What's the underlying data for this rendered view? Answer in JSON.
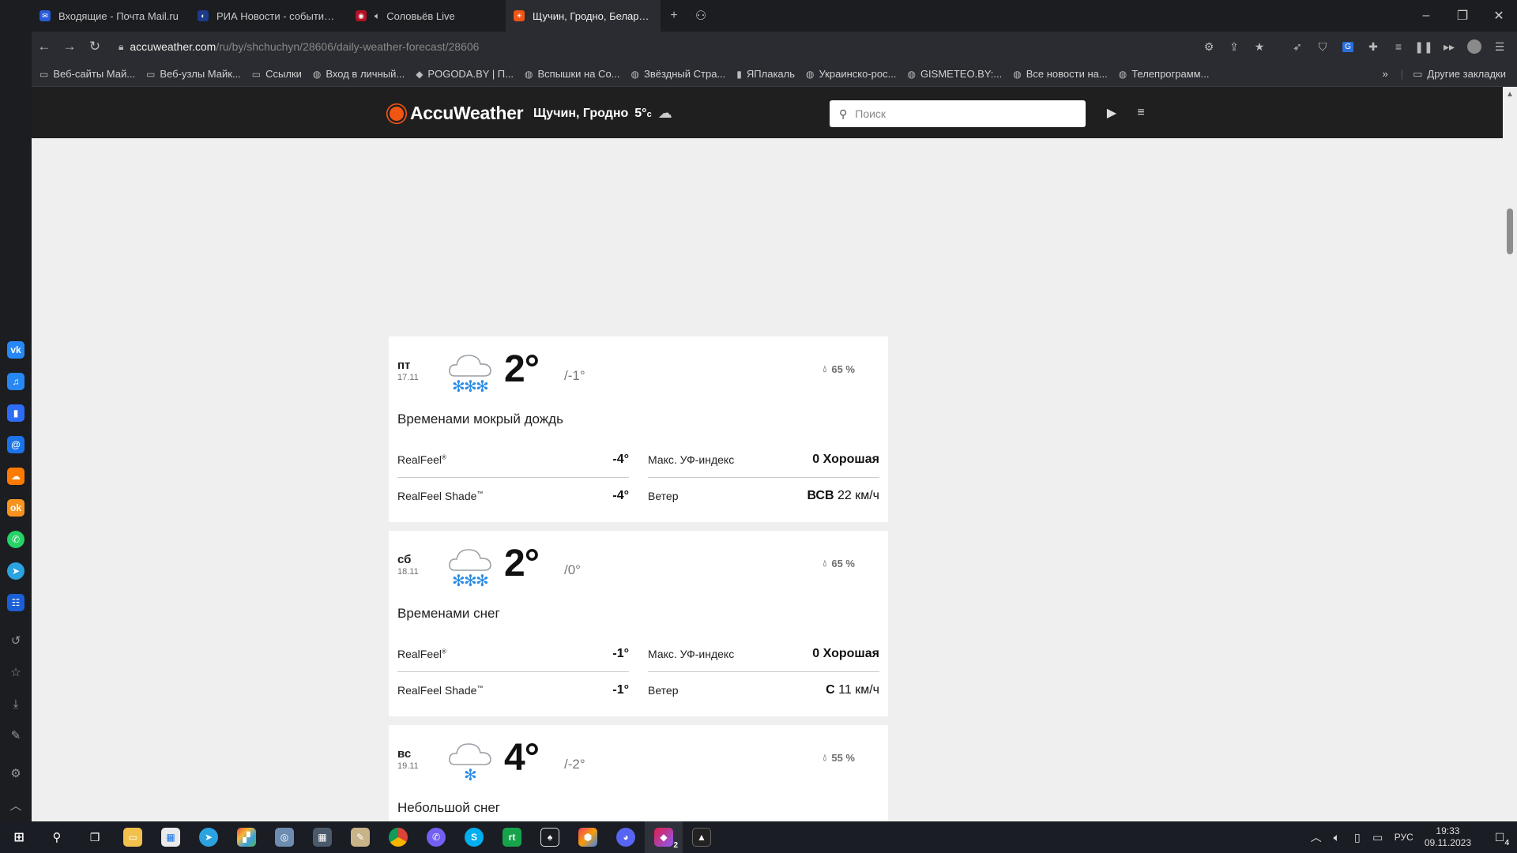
{
  "browser": {
    "tabs": [
      {
        "title": "Входящие - Почта Mail.ru",
        "color": "#2a5bd7",
        "glyph": "✉",
        "audio": false,
        "active": false
      },
      {
        "title": "РИА Новости - события в М",
        "color": "#1e3a8a",
        "glyph": "◐",
        "audio": false,
        "active": false
      },
      {
        "title": "Соловьёв Live",
        "color": "#b11226",
        "glyph": "◉",
        "audio": true,
        "active": false
      },
      {
        "title": "Щучин, Гродно, Беларусь Е",
        "color": "#f05514",
        "glyph": "☀",
        "audio": false,
        "active": true
      }
    ],
    "new_tab": "+",
    "url_host": "accuweather.com",
    "url_path": "/ru/by/shchuchyn/28606/daily-weather-forecast/28606",
    "bookmarks": [
      {
        "label": "Веб-сайты Май...",
        "icon": "folder-icon",
        "glyph": "▭"
      },
      {
        "label": "Веб-узлы Майк...",
        "icon": "folder-icon",
        "glyph": "▭"
      },
      {
        "label": "Ссылки",
        "icon": "folder-icon",
        "glyph": "▭"
      },
      {
        "label": "Вход в личный...",
        "icon": "globe-icon",
        "glyph": "◍"
      },
      {
        "label": "POGODA.BY | П...",
        "icon": "pogoda-icon",
        "glyph": "◆"
      },
      {
        "label": "Вспышки на Со...",
        "icon": "globe-icon",
        "glyph": "◍"
      },
      {
        "label": "Звёздный Стра...",
        "icon": "globe-icon",
        "glyph": "◍"
      },
      {
        "label": "ЯПлакаль",
        "icon": "yaplakal-icon",
        "glyph": "▮"
      },
      {
        "label": "Украинско-рос...",
        "icon": "globe-icon",
        "glyph": "◍"
      },
      {
        "label": "GISMETEO.BY:...",
        "icon": "globe-icon",
        "glyph": "◍"
      },
      {
        "label": "Все новости на...",
        "icon": "globe-icon",
        "glyph": "◍"
      },
      {
        "label": "Телепрограмм...",
        "icon": "globe-icon",
        "glyph": "◍"
      }
    ],
    "bookmarks_more": "»",
    "other_bookmarks": "Другие закладки"
  },
  "accuweather": {
    "logo": "AccuWeather",
    "location": "Щучин, Гродно",
    "current_temp": "5°",
    "current_unit": "c",
    "search_placeholder": "Поиск",
    "accent": "#f05514"
  },
  "forecast": [
    {
      "dow": "пт",
      "date": "17.11",
      "icon": "snow-heavy-icon",
      "flakes": 3,
      "high": "2°",
      "low": "/-1°",
      "precip": "65 %",
      "phrase": "Временами мокрый дождь",
      "realfeel_label": "RealFeel",
      "realfeel_sup": "®",
      "realfeel": "-4°",
      "realfeel_shade_label": "RealFeel Shade",
      "realfeel_shade_sup": "™",
      "realfeel_shade": "-4°",
      "uv_label": "Макс. УФ-индекс",
      "uv": "0 Хорошая",
      "wind_label": "Ветер",
      "wind_dir": "ВСВ",
      "wind_speed": "22 км/ч"
    },
    {
      "dow": "сб",
      "date": "18.11",
      "icon": "snow-heavy-icon",
      "flakes": 3,
      "high": "2°",
      "low": "/0°",
      "precip": "65 %",
      "phrase": "Временами снег",
      "realfeel_label": "RealFeel",
      "realfeel_sup": "®",
      "realfeel": "-1°",
      "realfeel_shade_label": "RealFeel Shade",
      "realfeel_shade_sup": "™",
      "realfeel_shade": "-1°",
      "uv_label": "Макс. УФ-индекс",
      "uv": "0 Хорошая",
      "wind_label": "Ветер",
      "wind_dir": "С",
      "wind_speed": "11 км/ч"
    },
    {
      "dow": "вс",
      "date": "19.11",
      "icon": "snow-light-icon",
      "flakes": 1,
      "high": "4°",
      "low": "/-2°",
      "precip": "55 %",
      "phrase": "Небольшой снег"
    }
  ],
  "taskbar": {
    "language": "РУС",
    "time": "19:33",
    "date": "09.11.2023",
    "notification_count": "4",
    "discord_badge": "2"
  }
}
